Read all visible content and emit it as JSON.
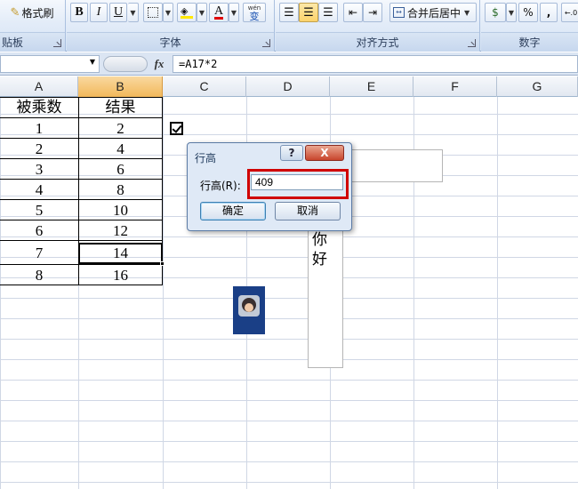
{
  "ribbon": {
    "format_painter": "格式刷",
    "clipboard_label": "贴板",
    "font_label": "字体",
    "bold": "B",
    "italic": "I",
    "underline": "U",
    "font_color_letter": "A",
    "wen_label": "wén",
    "wen_char": "变",
    "alignment_label": "对齐方式",
    "merge_center": "合并后居中",
    "number_label": "数字",
    "percent": "%",
    "comma": ","
  },
  "formula_bar": {
    "fx": "fx",
    "formula": "=A17*2"
  },
  "columns": [
    "A",
    "B",
    "C",
    "D",
    "E",
    "F",
    "G"
  ],
  "table": {
    "headers": [
      "被乘数",
      "结果"
    ],
    "rows": [
      [
        "1",
        "2"
      ],
      [
        "2",
        "4"
      ],
      [
        "3",
        "6"
      ],
      [
        "4",
        "8"
      ],
      [
        "5",
        "10"
      ],
      [
        "6",
        "12"
      ],
      [
        "7",
        "14"
      ],
      [
        "8",
        "16"
      ]
    ]
  },
  "textbox": {
    "line1": "你",
    "line2": "好"
  },
  "dialog": {
    "title": "行高",
    "help": "?",
    "close": "X",
    "label": "行高(R):",
    "value": "409",
    "ok": "确定",
    "cancel": "取消"
  },
  "colors": {
    "selected_column": "#f2b85a",
    "highlight": "#d00000",
    "image_bg": "#1a3f86"
  }
}
